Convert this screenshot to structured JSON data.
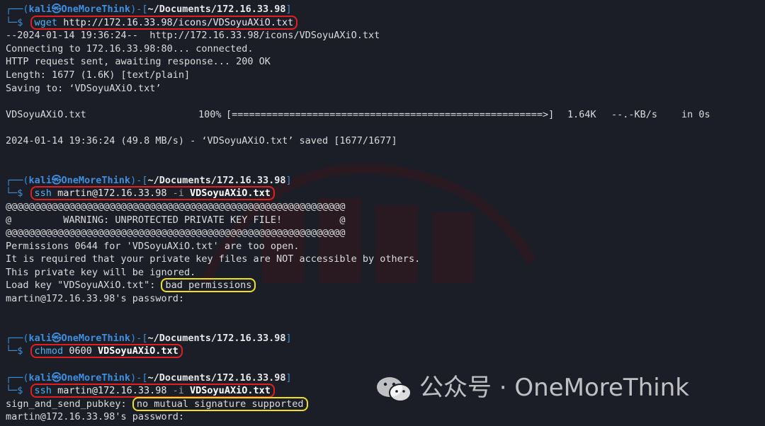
{
  "prompt": {
    "user": "kali",
    "at_symbol": "㉿",
    "host": "OneMoreThink",
    "dir": "~/Documents/172.16.33.98",
    "top_frame_start": "┌──(",
    "top_frame_mid": ")-[",
    "top_frame_end": "]",
    "bottom_frame": "└─$"
  },
  "blocks": {
    "wget_cmd": {
      "bin": "wget",
      "args": "http://172.16.33.98/icons/VDSoyuAXiO.txt"
    },
    "wget_out": [
      "--2024-01-14 19:36:24--  http://172.16.33.98/icons/VDSoyuAXiO.txt",
      "Connecting to 172.16.33.98:80... connected.",
      "HTTP request sent, awaiting response... 200 OK",
      "Length: 1677 (1.6K) [text/plain]",
      "Saving to: ‘VDSoyuAXiO.txt’"
    ],
    "progress": {
      "file": "VDSoyuAXiO.txt",
      "percent": "100%",
      "size": "1.64K",
      "rate": "--.-KB/s",
      "time": "in 0s",
      "fill_fraction": 1.0
    },
    "wget_saved": "2024-01-14 19:36:24 (49.8 MB/s) - ‘VDSoyuAXiO.txt’ saved [1677/1677]",
    "ssh1_cmd": {
      "bin": "ssh",
      "args": "martin@172.16.33.98",
      "flag": "-i",
      "file": "VDSoyuAXiO.txt"
    },
    "ssh1_out": [
      "@@@@@@@@@@@@@@@@@@@@@@@@@@@@@@@@@@@@@@@@@@@@@@@@@@@@@@@@@@@",
      "@         WARNING: UNPROTECTED PRIVATE KEY FILE!          @",
      "@@@@@@@@@@@@@@@@@@@@@@@@@@@@@@@@@@@@@@@@@@@@@@@@@@@@@@@@@@@",
      "Permissions 0644 for 'VDSoyuAXiO.txt' are too open.",
      "It is required that your private key files are NOT accessible by others.",
      "This private key will be ignored."
    ],
    "load_key_prefix": "Load key \"VDSoyuAXiO.txt\": ",
    "load_key_error": "bad permissions",
    "password_prompt": "martin@172.16.33.98's password:",
    "chmod_cmd": {
      "bin": "chmod",
      "args": "0600",
      "file": "VDSoyuAXiO.txt"
    },
    "ssh2_cmd": {
      "bin": "ssh",
      "args": "martin@172.16.33.98",
      "flag": "-i",
      "file": "VDSoyuAXiO.txt"
    },
    "sign_prefix": "sign_and_send_pubkey: ",
    "sign_error": "no mutual signature supported",
    "password_prompt2": "martin@172.16.33.98's password:"
  },
  "watermark": {
    "text": "公众号 · OneMoreThink",
    "icon": "wechat-icon"
  },
  "colors": {
    "background": "#1b1e26",
    "prompt_frame": "#3a8fd6",
    "command_bin": "#4fb3f0",
    "highlight_red": "#e02020",
    "highlight_yellow": "#f0e020"
  }
}
